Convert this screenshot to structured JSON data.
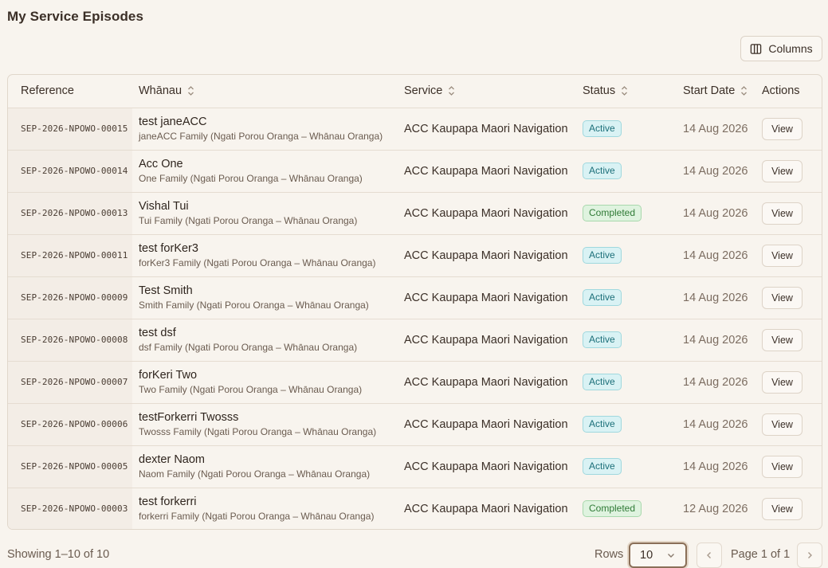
{
  "page_title": "My Service Episodes",
  "toolbar": {
    "columns_label": "Columns",
    "columns_icon": "columns-icon"
  },
  "table": {
    "headers": {
      "reference": "Reference",
      "whanau": "Whānau",
      "service": "Service",
      "status": "Status",
      "start_date": "Start Date",
      "actions": "Actions"
    },
    "rows": [
      {
        "reference": "SEP-2026-NPOWO-00015",
        "name": "test janeACC",
        "family": "janeACC Family (Ngati Porou Oranga – Whānau Oranga)",
        "service": "ACC Kaupapa Maori Navigation",
        "status": "Active",
        "start_date": "14 Aug 2026",
        "action": "View"
      },
      {
        "reference": "SEP-2026-NPOWO-00014",
        "name": "Acc One",
        "family": "One Family (Ngati Porou Oranga – Whānau Oranga)",
        "service": "ACC Kaupapa Maori Navigation",
        "status": "Active",
        "start_date": "14 Aug 2026",
        "action": "View"
      },
      {
        "reference": "SEP-2026-NPOWO-00013",
        "name": "Vishal Tui",
        "family": "Tui Family (Ngati Porou Oranga – Whānau Oranga)",
        "service": "ACC Kaupapa Maori Navigation",
        "status": "Completed",
        "start_date": "14 Aug 2026",
        "action": "View"
      },
      {
        "reference": "SEP-2026-NPOWO-00011",
        "name": "test forKer3",
        "family": "forKer3 Family (Ngati Porou Oranga – Whānau Oranga)",
        "service": "ACC Kaupapa Maori Navigation",
        "status": "Active",
        "start_date": "14 Aug 2026",
        "action": "View"
      },
      {
        "reference": "SEP-2026-NPOWO-00009",
        "name": "Test Smith",
        "family": "Smith Family (Ngati Porou Oranga – Whānau Oranga)",
        "service": "ACC Kaupapa Maori Navigation",
        "status": "Active",
        "start_date": "14 Aug 2026",
        "action": "View"
      },
      {
        "reference": "SEP-2026-NPOWO-00008",
        "name": "test dsf",
        "family": "dsf Family (Ngati Porou Oranga – Whānau Oranga)",
        "service": "ACC Kaupapa Maori Navigation",
        "status": "Active",
        "start_date": "14 Aug 2026",
        "action": "View"
      },
      {
        "reference": "SEP-2026-NPOWO-00007",
        "name": "forKeri Two",
        "family": "Two Family (Ngati Porou Oranga – Whānau Oranga)",
        "service": "ACC Kaupapa Maori Navigation",
        "status": "Active",
        "start_date": "14 Aug 2026",
        "action": "View"
      },
      {
        "reference": "SEP-2026-NPOWO-00006",
        "name": "testForkerri Twosss",
        "family": "Twosss Family (Ngati Porou Oranga – Whānau Oranga)",
        "service": "ACC Kaupapa Maori Navigation",
        "status": "Active",
        "start_date": "14 Aug 2026",
        "action": "View"
      },
      {
        "reference": "SEP-2026-NPOWO-00005",
        "name": "dexter Naom",
        "family": "Naom Family (Ngati Porou Oranga – Whānau Oranga)",
        "service": "ACC Kaupapa Maori Navigation",
        "status": "Active",
        "start_date": "14 Aug 2026",
        "action": "View"
      },
      {
        "reference": "SEP-2026-NPOWO-00003",
        "name": "test forkerri",
        "family": "forkerri Family (Ngati Porou Oranga – Whānau Oranga)",
        "service": "ACC Kaupapa Maori Navigation",
        "status": "Completed",
        "start_date": "12 Aug 2026",
        "action": "View"
      }
    ]
  },
  "footer": {
    "showing": "Showing 1–10 of 10",
    "rows_label": "Rows",
    "rows_value": "10",
    "page_info": "Page 1 of 1"
  },
  "colors": {
    "background": "#f8f4ee",
    "active_badge_bg": "#d9f2f4",
    "active_badge_text": "#1c6f79",
    "completed_badge_bg": "#dff3df",
    "completed_badge_text": "#2f7a36",
    "select_border": "#8a6f58"
  }
}
